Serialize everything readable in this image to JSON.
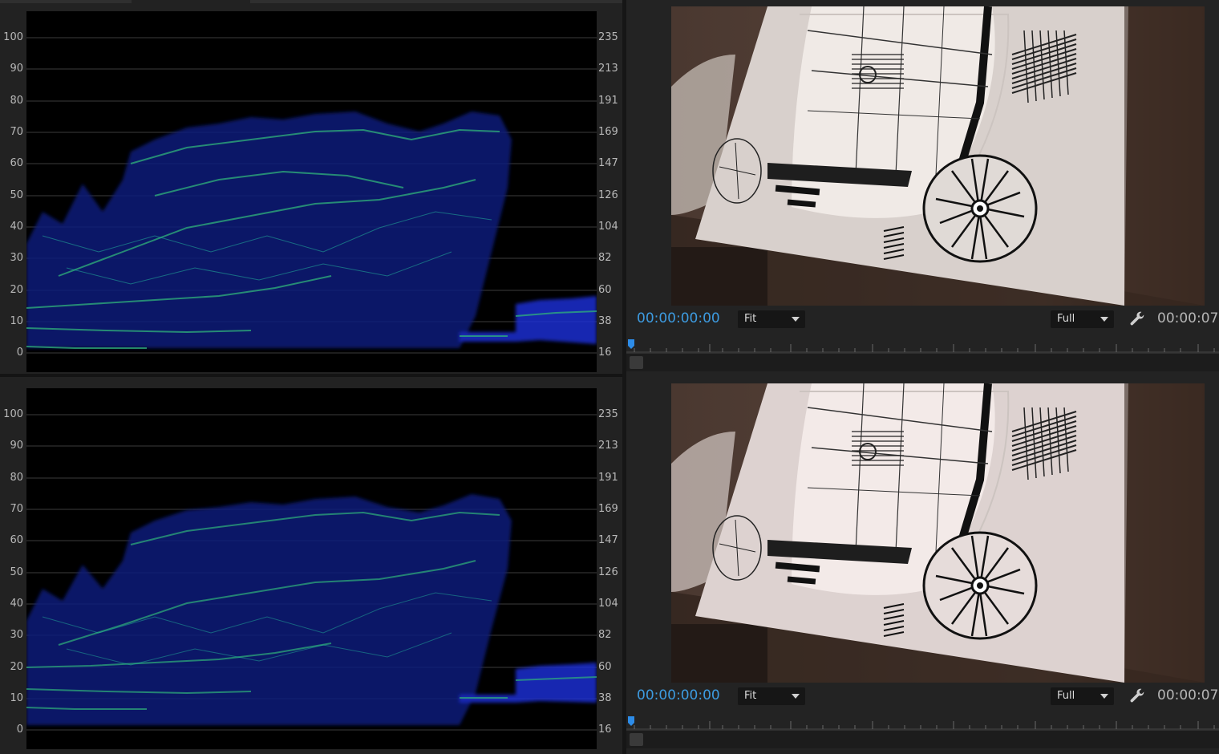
{
  "scopes": [
    {
      "name": "top",
      "left_axis": [
        "100",
        "90",
        "80",
        "70",
        "60",
        "50",
        "40",
        "30",
        "20",
        "10",
        "0"
      ],
      "right_axis": [
        "235",
        "213",
        "191",
        "169",
        "147",
        "126",
        "104",
        "82",
        "60",
        "38",
        "16"
      ],
      "colors": {
        "trace_green": "#2fb27a",
        "trace_blue": "#1a2fd0",
        "grid": "#3c3c3c"
      }
    },
    {
      "name": "bottom",
      "left_axis": [
        "100",
        "90",
        "80",
        "70",
        "60",
        "50",
        "40",
        "30",
        "20",
        "10",
        "0"
      ],
      "right_axis": [
        "235",
        "213",
        "191",
        "169",
        "147",
        "126",
        "104",
        "82",
        "60",
        "38",
        "16"
      ],
      "colors": {
        "trace_green": "#2fb27a",
        "trace_blue": "#1a2fd0",
        "grid": "#3c3c3c"
      }
    }
  ],
  "monitors": [
    {
      "name": "top",
      "timecode_in": "00:00:00:00",
      "zoom": "Fit",
      "resolution": "Full",
      "timecode_out": "00:00:07",
      "icons": {
        "settings": "wrench-icon",
        "playhead": "playhead-icon"
      }
    },
    {
      "name": "bottom",
      "timecode_in": "00:00:00:00",
      "zoom": "Fit",
      "resolution": "Full",
      "timecode_out": "00:00:07",
      "icons": {
        "settings": "wrench-icon",
        "playhead": "playhead-icon"
      }
    }
  ],
  "colors": {
    "timecode_accent": "#3d9be0",
    "panel_bg": "#232323"
  }
}
